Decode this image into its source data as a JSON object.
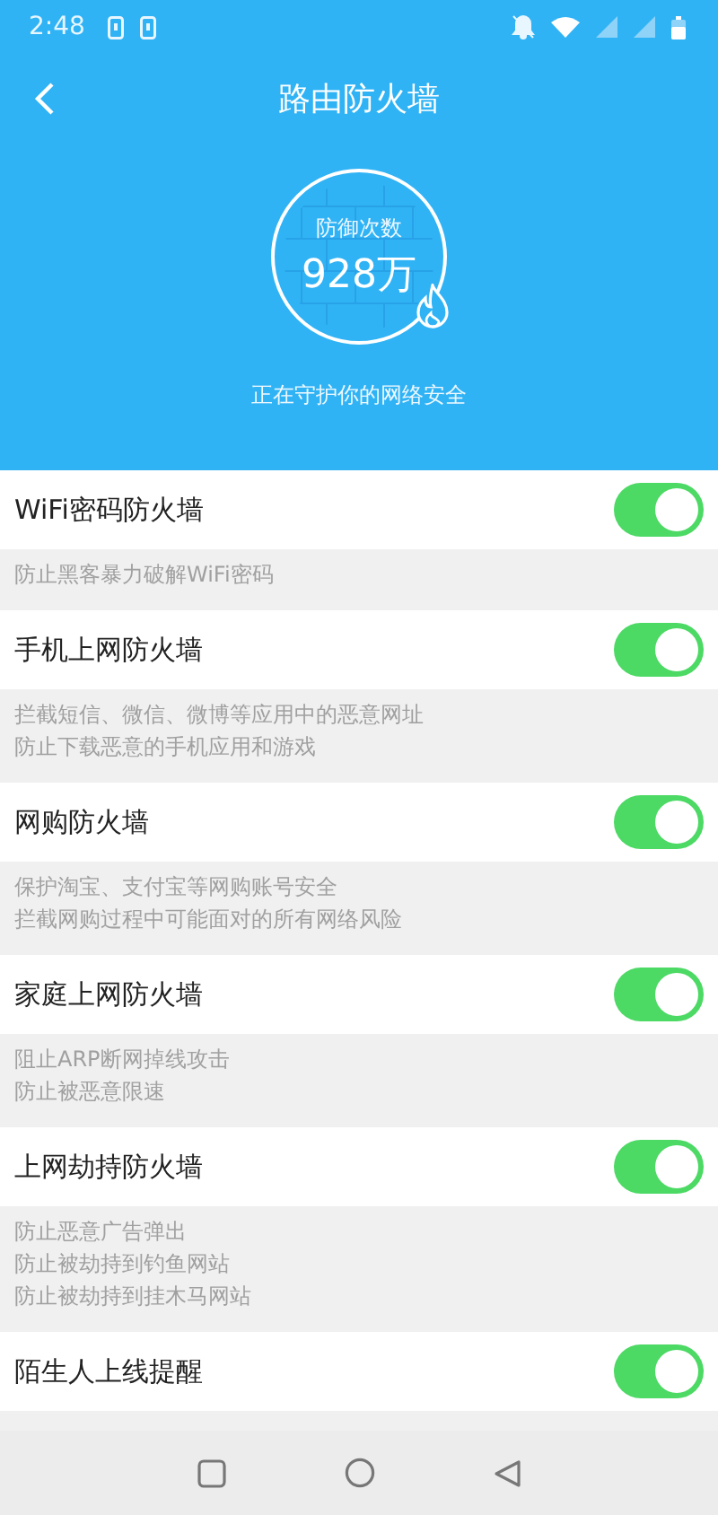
{
  "status_bar": {
    "time": "2:48"
  },
  "header": {
    "title": "路由防火墙",
    "counter_label": "防御次数",
    "counter_value": "928万",
    "subtitle": "正在守护你的网络安全"
  },
  "settings": [
    {
      "title": "WiFi密码防火墙",
      "on": true,
      "description": [
        "防止黑客暴力破解WiFi密码"
      ]
    },
    {
      "title": "手机上网防火墙",
      "on": true,
      "description": [
        "拦截短信、微信、微博等应用中的恶意网址",
        "防止下载恶意的手机应用和游戏"
      ]
    },
    {
      "title": "网购防火墙",
      "on": true,
      "description": [
        "保护淘宝、支付宝等网购账号安全",
        "拦截网购过程中可能面对的所有网络风险"
      ]
    },
    {
      "title": "家庭上网防火墙",
      "on": true,
      "description": [
        "阻止ARP断网掉线攻击",
        "防止被恶意限速"
      ]
    },
    {
      "title": "上网劫持防火墙",
      "on": true,
      "description": [
        "防止恶意广告弹出",
        "防止被劫持到钓鱼网站",
        "防止被劫持到挂木马网站"
      ]
    },
    {
      "title": "陌生人上线提醒",
      "on": true
    }
  ]
}
